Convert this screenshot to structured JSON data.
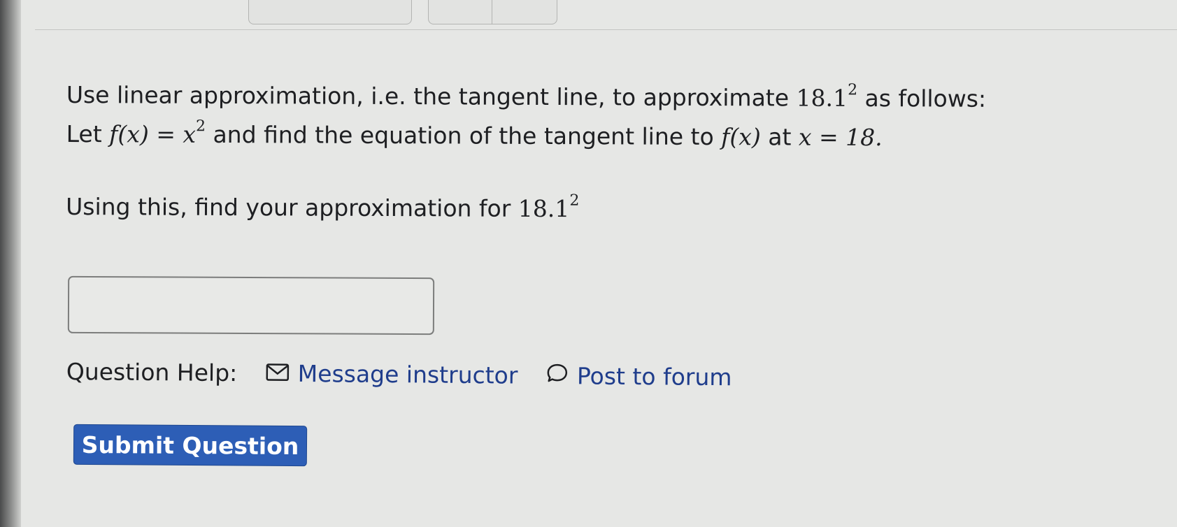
{
  "question": {
    "line1_a": "Use linear approximation, i.e. the tangent line, to approximate ",
    "line1_base": "18.1",
    "line1_exp": "2",
    "line1_b": " as follows:",
    "line2_a": "Let ",
    "line2_fx": "f(x) = x",
    "line2_exp": "2",
    "line2_b": " and find the equation of the tangent line to ",
    "line2_fx2": "f(x)",
    "line2_c": " at ",
    "line2_eq": "x = 18.",
    "line3_a": "Using this, find your approximation for ",
    "line3_base": "18.1",
    "line3_exp": "2"
  },
  "answer": {
    "value": ""
  },
  "help": {
    "label": "Question Help:",
    "message_link": "Message instructor",
    "forum_link": "Post to forum",
    "message_icon": "envelope-icon",
    "forum_icon": "speech-bubble-icon"
  },
  "submit": {
    "label": "Submit Question"
  },
  "colors": {
    "link": "#1f3d8c",
    "button": "#2d5eb6",
    "background": "#e6e7e5"
  }
}
